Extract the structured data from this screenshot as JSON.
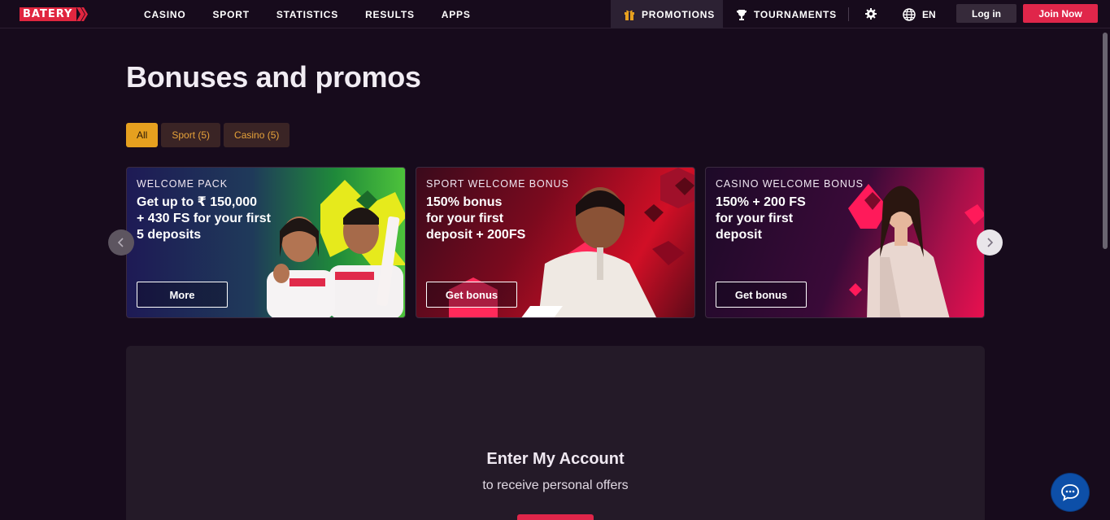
{
  "brand": {
    "logo_text": "BATERY"
  },
  "nav": {
    "links": [
      "CASINO",
      "SPORT",
      "STATISTICS",
      "RESULTS",
      "APPS"
    ],
    "promotions": "PROMOTIONS",
    "tournaments": "TOURNAMENTS",
    "language": "EN",
    "login": "Log in",
    "join": "Join Now"
  },
  "page": {
    "title": "Bonuses and promos"
  },
  "filters": [
    {
      "label": "All",
      "active": true
    },
    {
      "label": "Sport (5)",
      "active": false
    },
    {
      "label": "Casino (5)",
      "active": false
    }
  ],
  "cards": [
    {
      "kicker": "WELCOME PACK",
      "text_lines": [
        "Get up to ₹ 150,000",
        "+ 430 FS for your first",
        "5 deposits"
      ],
      "button": "More"
    },
    {
      "kicker": "SPORT WELCOME BONUS",
      "text_lines": [
        "150% bonus",
        "for your first",
        "deposit + 200FS"
      ],
      "button": "Get bonus"
    },
    {
      "kicker": "CASINO WELCOME BONUS",
      "text_lines": [
        "150% + 200 FS",
        "for your first",
        "deposit"
      ],
      "button": "Get bonus"
    }
  ],
  "account": {
    "title": "Enter My Account",
    "subtitle": "to receive personal offers"
  },
  "colors": {
    "background": "#170b1c",
    "accent_red": "#e0264a",
    "filter_active": "#e6a01f",
    "panel": "#241a28"
  },
  "icons": {
    "promotions": "gift-icon",
    "tournaments": "trophy-icon",
    "settings": "gear-icon",
    "language": "globe-icon",
    "chat": "chat-bubble-icon",
    "carousel_prev": "chevron-left-icon",
    "carousel_next": "chevron-right-icon"
  }
}
